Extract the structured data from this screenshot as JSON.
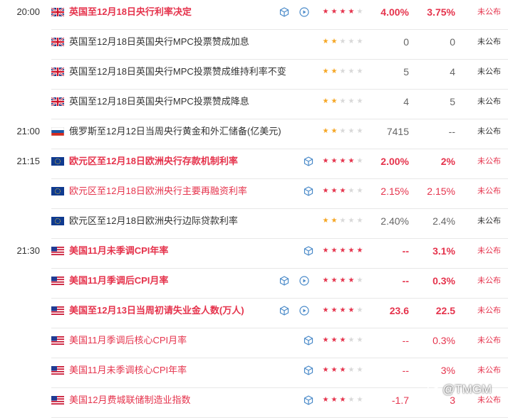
{
  "colors": {
    "accent": "#e5334c",
    "importance_low": "#f5a623",
    "star_off": "#d8d8d8",
    "text": "#333333"
  },
  "rows": [
    {
      "time": "20:00",
      "flag": "uk-flag-icon",
      "title": "英国至12月18日央行利率决定",
      "importance": 4,
      "previous": "4.00%",
      "forecast": "3.75%",
      "status": "未公布",
      "highlight": true,
      "bold": true,
      "icons": [
        "cube-icon",
        "play-icon"
      ]
    },
    {
      "time": "",
      "flag": "uk-flag-icon",
      "title": "英国至12月18日英国央行MPC投票赞成加息",
      "importance": 2,
      "previous": "0",
      "forecast": "0",
      "status": "未公布",
      "highlight": false,
      "bold": false,
      "icons": []
    },
    {
      "time": "",
      "flag": "uk-flag-icon",
      "title": "英国至12月18日英国央行MPC投票赞成维持利率不变",
      "importance": 2,
      "previous": "5",
      "forecast": "4",
      "status": "未公布",
      "highlight": false,
      "bold": false,
      "icons": []
    },
    {
      "time": "",
      "flag": "uk-flag-icon",
      "title": "英国至12月18日英国央行MPC投票赞成降息",
      "importance": 2,
      "previous": "4",
      "forecast": "5",
      "status": "未公布",
      "highlight": false,
      "bold": false,
      "icons": []
    },
    {
      "time": "21:00",
      "flag": "russia-flag-icon",
      "title": "俄罗斯至12月12日当周央行黄金和外汇储备(亿美元)",
      "importance": 2,
      "previous": "7415",
      "forecast": "--",
      "status": "未公布",
      "highlight": false,
      "bold": false,
      "icons": []
    },
    {
      "time": "21:15",
      "flag": "eu-flag-icon",
      "title": "欧元区至12月18日欧洲央行存款机制利率",
      "importance": 4,
      "previous": "2.00%",
      "forecast": "2%",
      "status": "未公布",
      "highlight": true,
      "bold": true,
      "icons": [
        "cube-icon"
      ]
    },
    {
      "time": "",
      "flag": "eu-flag-icon",
      "title": "欧元区至12月18日欧洲央行主要再融资利率",
      "importance": 3,
      "previous": "2.15%",
      "forecast": "2.15%",
      "status": "未公布",
      "highlight": true,
      "bold": false,
      "icons": [
        "cube-icon"
      ]
    },
    {
      "time": "",
      "flag": "eu-flag-icon",
      "title": "欧元区至12月18日欧洲央行边际贷款利率",
      "importance": 2,
      "previous": "2.40%",
      "forecast": "2.4%",
      "status": "未公布",
      "highlight": false,
      "bold": false,
      "icons": []
    },
    {
      "time": "21:30",
      "flag": "us-flag-icon",
      "title": "美国11月未季调CPI年率",
      "importance": 5,
      "previous": "--",
      "forecast": "3.1%",
      "status": "未公布",
      "highlight": true,
      "bold": true,
      "icons": [
        "cube-icon"
      ]
    },
    {
      "time": "",
      "flag": "us-flag-icon",
      "title": "美国11月季调后CPI月率",
      "importance": 4,
      "previous": "--",
      "forecast": "0.3%",
      "status": "未公布",
      "highlight": true,
      "bold": true,
      "icons": [
        "cube-icon",
        "play-icon"
      ]
    },
    {
      "time": "",
      "flag": "us-flag-icon",
      "title": "美国至12月13日当周初请失业金人数(万人)",
      "importance": 4,
      "previous": "23.6",
      "forecast": "22.5",
      "status": "未公布",
      "highlight": true,
      "bold": true,
      "icons": [
        "cube-icon",
        "play-icon"
      ]
    },
    {
      "time": "",
      "flag": "us-flag-icon",
      "title": "美国11月季调后核心CPI月率",
      "importance": 3,
      "previous": "--",
      "forecast": "0.3%",
      "status": "未公布",
      "highlight": true,
      "bold": false,
      "icons": [
        "cube-icon"
      ]
    },
    {
      "time": "",
      "flag": "us-flag-icon",
      "title": "美国11月未季调核心CPI年率",
      "importance": 3,
      "previous": "--",
      "forecast": "3%",
      "status": "未公布",
      "highlight": true,
      "bold": false,
      "icons": [
        "cube-icon"
      ]
    },
    {
      "time": "",
      "flag": "us-flag-icon",
      "title": "美国12月费城联储制造业指数",
      "importance": 3,
      "previous": "-1.7",
      "forecast": "3",
      "status": "未公布",
      "highlight": true,
      "bold": false,
      "icons": [
        "cube-icon"
      ]
    }
  ],
  "watermark": {
    "text": "@TMGM",
    "icon": "wechat-icon"
  }
}
